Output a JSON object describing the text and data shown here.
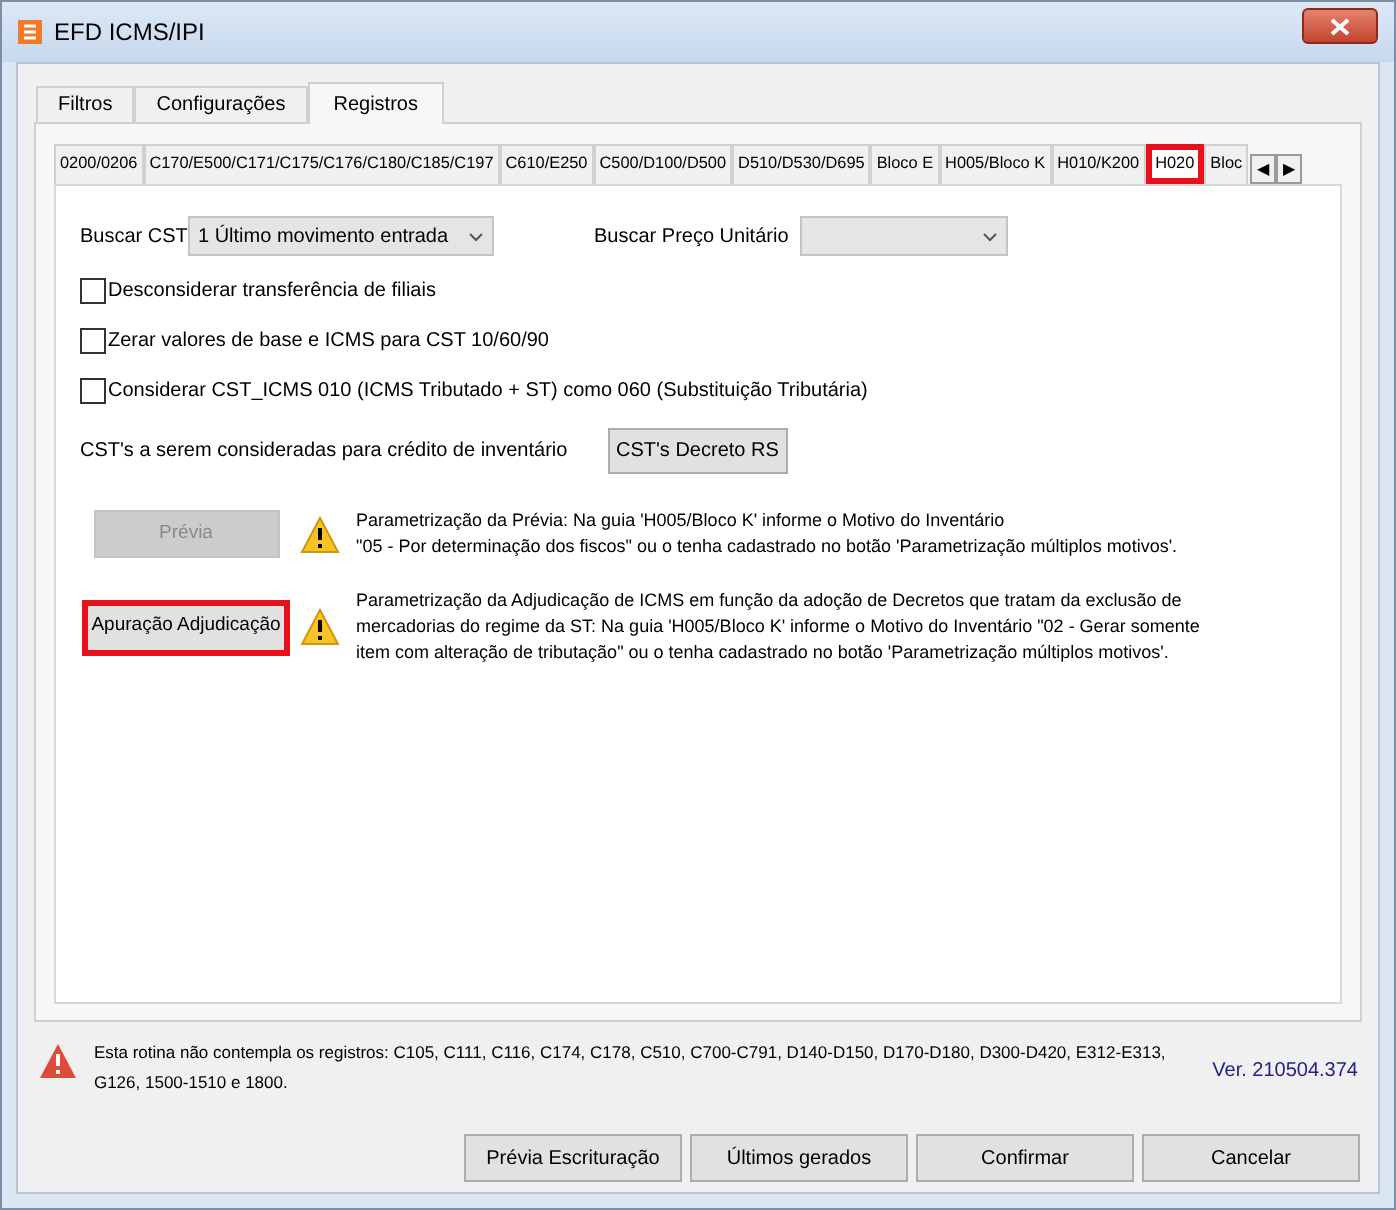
{
  "window": {
    "title": "EFD ICMS/IPI"
  },
  "tabs": [
    {
      "label": "Filtros",
      "selected": false
    },
    {
      "label": "Configurações",
      "selected": false
    },
    {
      "label": "Registros",
      "selected": true
    }
  ],
  "subtabs": [
    {
      "label": "0200/0206",
      "selected": false,
      "highlighted": false
    },
    {
      "label": "C170/E500/C171/C175/C176/C180/C185/C197",
      "selected": false,
      "highlighted": false
    },
    {
      "label": "C610/E250",
      "selected": false,
      "highlighted": false
    },
    {
      "label": "C500/D100/D500",
      "selected": false,
      "highlighted": false
    },
    {
      "label": "D510/D530/D695",
      "selected": false,
      "highlighted": false
    },
    {
      "label": "Bloco E",
      "selected": false,
      "highlighted": false
    },
    {
      "label": "H005/Bloco K",
      "selected": false,
      "highlighted": false
    },
    {
      "label": "H010/K200",
      "selected": false,
      "highlighted": false
    },
    {
      "label": "H020",
      "selected": true,
      "highlighted": true
    },
    {
      "label": "Bloc",
      "selected": false,
      "highlighted": false
    }
  ],
  "subtab_scroll": [
    "◀",
    "▶"
  ],
  "buscar_cst": {
    "label": "Buscar CST",
    "value": "1 Último movimento entrada"
  },
  "buscar_preco": {
    "label": "Buscar Preço Unitário"
  },
  "options": [
    {
      "label": "Desconsiderar transferência de filiais",
      "checked": false
    },
    {
      "label": "Zerar valores de base e ICMS para CST 10/60/90",
      "checked": false
    },
    {
      "label": "Considerar CST_ICMS 010 (ICMS Tributado + ST) como 060 (Substituição Tributária)",
      "checked": false
    }
  ],
  "cst_credito": {
    "label": "CST's a serem consideradas para crédito de inventário",
    "button": "CST's Decreto RS"
  },
  "actions": [
    {
      "button": "Prévia",
      "disabled": true,
      "highlighted": false,
      "lines": [
        "Parametrização da Prévia: Na guia 'H005/Bloco K' informe o Motivo do Inventário",
        "\"05 - Por determinação dos fiscos\" ou o tenha cadastrado no botão 'Parametrização múltiplos motivos'."
      ]
    },
    {
      "button": "Apuração Adjudicação",
      "disabled": false,
      "highlighted": true,
      "lines": [
        "Parametrização da Adjudicação de ICMS em função da adoção de Decretos que tratam da exclusão de",
        "mercadorias do regime da ST: Na guia 'H005/Bloco K' informe o Motivo do Inventário \"02 - Gerar somente",
        "item com alteração de tributação\" ou o tenha cadastrado no botão 'Parametrização múltiplos motivos'."
      ]
    }
  ],
  "notice": {
    "lines": [
      "Esta rotina não contempla os registros: C105, C111, C116, C174, C178, C510, C700-C791, D140-D150, D170-D180, D300-D420, E312-E313,",
      "G126, 1500-1510 e 1800."
    ],
    "version": "Ver. 210504.374"
  },
  "buttons": [
    "Prévia Escrituração",
    "Últimos gerados",
    "Confirmar",
    "Cancelar"
  ]
}
